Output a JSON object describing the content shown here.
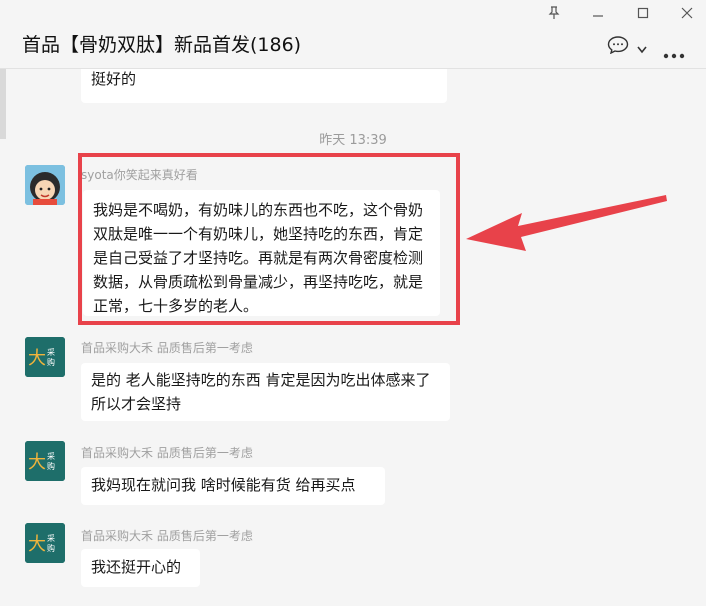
{
  "window": {
    "title": "首品【骨奶双肽】新品首发(186)",
    "controls": {
      "pin": "pin-icon",
      "minimize": "minimize-icon",
      "maximize": "maximize-icon",
      "close": "close-icon"
    }
  },
  "header_actions": {
    "chat_icon": "chat-bubble-icon",
    "chevron_icon": "chevron-down-icon",
    "more_icon": "more-icon"
  },
  "messages": {
    "prev_bubble_tail": "挺好的",
    "timestamp": "昨天 13:39",
    "m1": {
      "sender": "syota你笑起来真好看",
      "text": "我妈是不喝奶，有奶味儿的东西也不吃，这个骨奶双肽是唯一一个有奶味儿，她坚持吃的东西，肯定是自己受益了才坚持吃。再就是有两次骨密度检测数据，从骨质疏松到骨量减少，再坚持吃吃，就是正常，七十多岁的老人。"
    },
    "m2": {
      "sender": "首品采购大禾 品质售后第一考虑",
      "text": "是的 老人能坚持吃的东西 肯定是因为吃出体感来了 所以才会坚持"
    },
    "m3": {
      "sender": "首品采购大禾 品质售后第一考虑",
      "text": "我妈现在就问我 啥时候能有货 给再买点"
    },
    "m4": {
      "sender": "首品采购大禾 品质售后第一考虑",
      "text": "我还挺开心的"
    }
  },
  "annotation": {
    "highlight_color": "#e8424a"
  },
  "colors": {
    "background": "#f5f5f5",
    "bubble": "#ffffff",
    "sender": "#a0a0a0"
  }
}
